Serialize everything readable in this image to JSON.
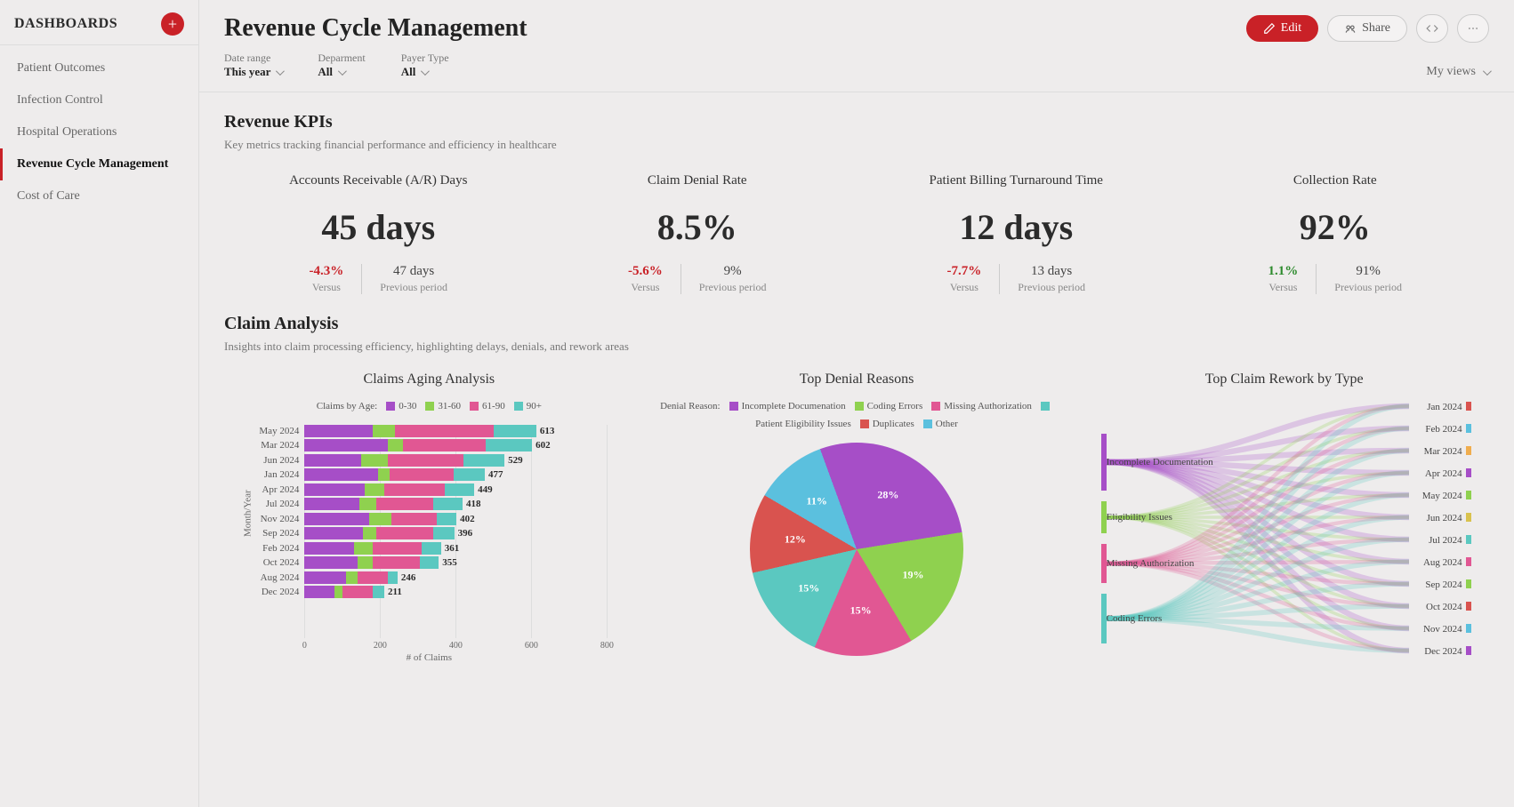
{
  "sidebar": {
    "title": "DASHBOARDS",
    "items": [
      "Patient Outcomes",
      "Infection Control",
      "Hospital Operations",
      "Revenue Cycle Management",
      "Cost of Care"
    ],
    "active_index": 3
  },
  "header": {
    "title": "Revenue Cycle Management",
    "edit_label": "Edit",
    "share_label": "Share",
    "my_views_label": "My views"
  },
  "filters": [
    {
      "label": "Date range",
      "value": "This year"
    },
    {
      "label": "Deparment",
      "value": "All"
    },
    {
      "label": "Payer Type",
      "value": "All"
    }
  ],
  "kpi_section": {
    "title": "Revenue KPIs",
    "subtitle": "Key metrics tracking financial performance and efficiency in healthcare",
    "versus_label": "Versus",
    "previous_label": "Previous period"
  },
  "kpis": [
    {
      "label": "Accounts Receivable (A/R) Days",
      "value": "45 days",
      "delta": "-4.3%",
      "direction": "neg",
      "previous": "47 days"
    },
    {
      "label": "Claim Denial Rate",
      "value": "8.5%",
      "delta": "-5.6%",
      "direction": "neg",
      "previous": "9%"
    },
    {
      "label": "Patient Billing Turnaround Time",
      "value": "12 days",
      "delta": "-7.7%",
      "direction": "neg",
      "previous": "13 days"
    },
    {
      "label": "Collection Rate",
      "value": "92%",
      "delta": "1.1%",
      "direction": "pos",
      "previous": "91%"
    }
  ],
  "claims_section": {
    "title": "Claim Analysis",
    "subtitle": "Insights into claim processing efficiency, highlighting delays, denials, and rework areas"
  },
  "colors": {
    "purple": "#a64ec7",
    "green": "#8fd14f",
    "pink": "#e15793",
    "teal": "#5bc8c0",
    "red": "#d9534f",
    "blue": "#5bc0de"
  },
  "chart_data": [
    {
      "type": "bar",
      "orientation": "horizontal-stacked",
      "title": "Claims Aging Analysis",
      "legend_title": "Claims by Age:",
      "xlabel": "# of Claims",
      "ylabel": "Month/Year",
      "x_ticks": [
        0,
        200,
        400,
        600,
        800
      ],
      "series_names": [
        "0-30",
        "31-60",
        "61-90",
        "90+"
      ],
      "series_colors": [
        "#a64ec7",
        "#8fd14f",
        "#e15793",
        "#5bc8c0"
      ],
      "categories": [
        "May 2024",
        "Mar 2024",
        "Jun 2024",
        "Jan 2024",
        "Apr 2024",
        "Jul 2024",
        "Nov 2024",
        "Sep 2024",
        "Feb 2024",
        "Oct 2024",
        "Aug 2024",
        "Dec 2024"
      ],
      "values": [
        [
          180,
          60,
          260,
          113
        ],
        [
          220,
          40,
          220,
          122
        ],
        [
          150,
          70,
          200,
          109
        ],
        [
          195,
          30,
          170,
          82
        ],
        [
          160,
          50,
          160,
          79
        ],
        [
          145,
          45,
          150,
          78
        ],
        [
          170,
          60,
          120,
          52
        ],
        [
          155,
          35,
          150,
          56
        ],
        [
          130,
          50,
          130,
          51
        ],
        [
          140,
          40,
          125,
          50
        ],
        [
          110,
          30,
          80,
          26
        ],
        [
          80,
          20,
          80,
          31
        ]
      ],
      "totals": [
        613,
        602,
        529,
        477,
        449,
        418,
        402,
        396,
        361,
        355,
        246,
        211
      ]
    },
    {
      "type": "pie",
      "title": "Top Denial Reasons",
      "legend_title": "Denial Reason:",
      "slices": [
        {
          "name": "Incomplete Documenation",
          "value": 28,
          "label": "28%",
          "color": "#a64ec7"
        },
        {
          "name": "Coding Errors",
          "value": 19,
          "label": "19%",
          "color": "#8fd14f"
        },
        {
          "name": "Missing Authorization",
          "value": 15,
          "label": "15%",
          "color": "#e15793"
        },
        {
          "name": "Patient Eligibility Issues",
          "value": 15,
          "label": "15%",
          "color": "#5bc8c0"
        },
        {
          "name": "Duplicates",
          "value": 12,
          "label": "12%",
          "color": "#d9534f"
        },
        {
          "name": "Other",
          "value": 11,
          "label": "11%",
          "color": "#5bc0de"
        }
      ]
    },
    {
      "type": "sankey",
      "title": "Top Claim Rework by Type",
      "sources": [
        {
          "name": "Incomplete Documentation",
          "color": "#a64ec7",
          "weight": 0.32
        },
        {
          "name": "Eligibility Issues",
          "color": "#8fd14f",
          "weight": 0.18
        },
        {
          "name": "Missing Authorization",
          "color": "#e15793",
          "weight": 0.22
        },
        {
          "name": "Coding Errors",
          "color": "#5bc8c0",
          "weight": 0.28
        }
      ],
      "targets": [
        "Jan 2024",
        "Feb 2024",
        "Mar 2024",
        "Apr 2024",
        "May 2024",
        "Jun 2024",
        "Jul 2024",
        "Aug 2024",
        "Sep 2024",
        "Oct 2024",
        "Nov 2024",
        "Dec 2024"
      ],
      "target_colors": [
        "#d9534f",
        "#5bc0de",
        "#f0ad4e",
        "#a64ec7",
        "#8fd14f",
        "#d9c24e",
        "#5bc8c0",
        "#e15793",
        "#8fd14f",
        "#d9534f",
        "#5bc0de",
        "#a64ec7"
      ]
    }
  ]
}
